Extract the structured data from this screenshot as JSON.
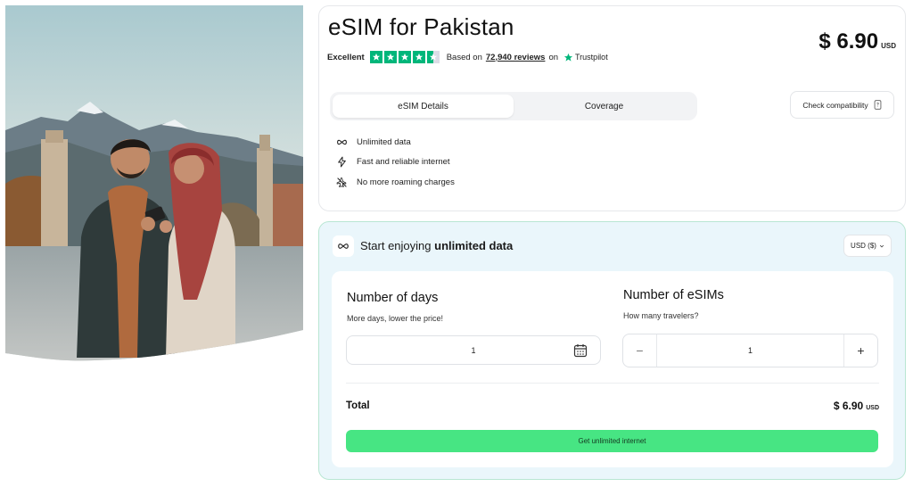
{
  "product": {
    "title": "eSIM for Pakistan",
    "price_amount": "$ 6.90",
    "price_currency": "USD"
  },
  "rating": {
    "label": "Excellent",
    "stars": 4.5,
    "based_on": "Based on",
    "reviews_count": "72,940 reviews",
    "on": "on",
    "provider": "Trustpilot",
    "star_color": "#00b67a"
  },
  "tabs": [
    {
      "label": "eSIM Details",
      "active": true
    },
    {
      "label": "Coverage",
      "active": false
    }
  ],
  "check_compatibility": {
    "label": "Check compatibility",
    "icon": "phone-question-icon"
  },
  "features": [
    {
      "icon": "infinity-icon",
      "text": "Unlimited data"
    },
    {
      "icon": "lightning-icon",
      "text": "Fast and reliable internet"
    },
    {
      "icon": "no-plane-icon",
      "text": "No more roaming charges"
    }
  ],
  "plan": {
    "header_prefix": "Start enjoying",
    "header_bold": "unlimited data",
    "currency_selector": "USD ($)",
    "days": {
      "title": "Number of days",
      "subtitle": "More days, lower the price!",
      "value": "1"
    },
    "esims": {
      "title": "Number of eSIMs",
      "subtitle": "How many travelers?",
      "value": "1",
      "minus": "−",
      "plus": "+"
    },
    "total_label": "Total",
    "total_amount": "$ 6.90",
    "total_currency": "USD",
    "cta": "Get unlimited internet",
    "cta_color": "#47e583",
    "accent_bg": "#eaf6fb"
  }
}
